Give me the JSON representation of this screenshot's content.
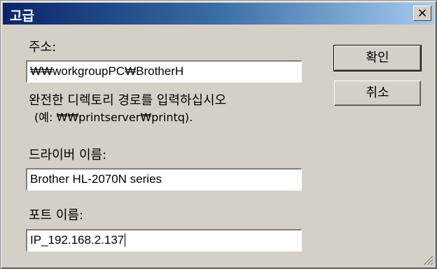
{
  "window": {
    "title": "고급",
    "close_label": "×"
  },
  "address": {
    "label": "주소:",
    "value": "₩₩workgroupPC₩BrotherH",
    "hint_line1": "완전한 디렉토리 경로를 입력하십시오",
    "hint_line2": "(예: ₩₩printserver₩printq)."
  },
  "driver": {
    "label": "드라이버 이름:",
    "value": "Brother HL-2070N series"
  },
  "port": {
    "label": "포트 이름:",
    "value": "IP_192.168.2.137"
  },
  "buttons": {
    "ok": "확인",
    "cancel": "취소"
  }
}
